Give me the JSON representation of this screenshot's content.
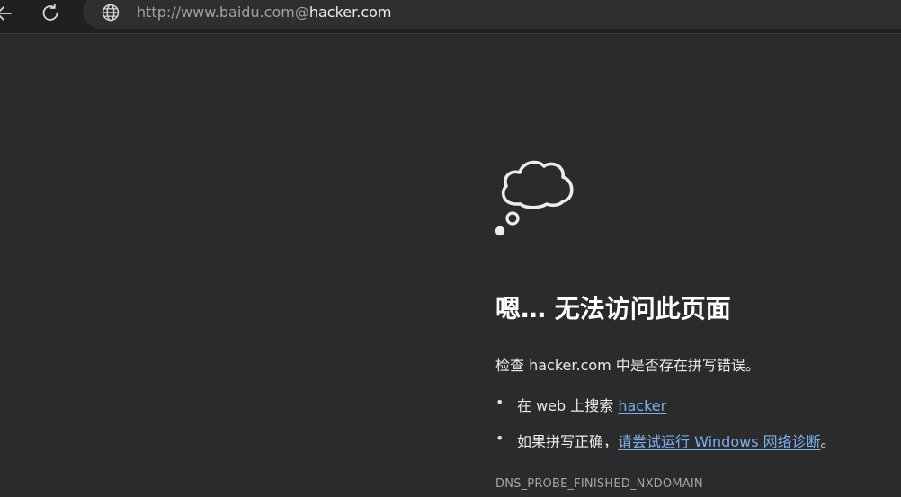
{
  "toolbar": {
    "back_icon": "arrow-left-icon",
    "refresh_icon": "refresh-icon",
    "site_icon": "globe-icon",
    "url_prefix": "http://www.baidu.com@",
    "url_host": "hacker.com"
  },
  "error_page": {
    "icon": "thought-cloud-icon",
    "title": "嗯… 无法访问此页面",
    "check_text": "检查 hacker.com 中是否存在拼写错误。",
    "suggestions": [
      {
        "bullet": "•",
        "prefix": "在 web 上搜索 ",
        "link": "hacker",
        "suffix": ""
      },
      {
        "bullet": "•",
        "prefix": "如果拼写正确，",
        "link": "请尝试运行 Windows 网络诊断",
        "suffix": "。"
      }
    ],
    "error_code": "DNS_PROBE_FINISHED_NXDOMAIN"
  },
  "colors": {
    "background": "#2b2b2b",
    "toolbar": "#202020",
    "link": "#7ab0f0",
    "title": "#ffffff"
  }
}
